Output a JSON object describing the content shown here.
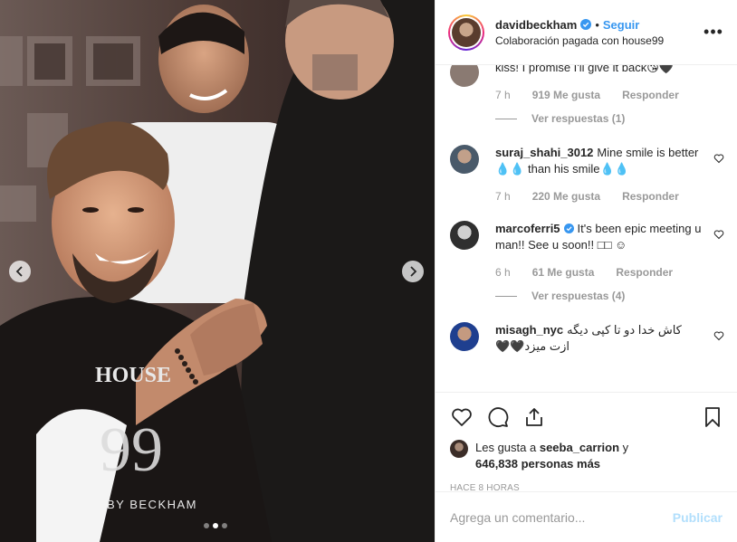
{
  "header": {
    "username": "davidbeckham",
    "separator": "•",
    "follow_label": "Seguir",
    "subtitle_prefix": "Colaboración pagada con",
    "partner": "house99",
    "more_label": "•••"
  },
  "comments": [
    {
      "user": "",
      "text": "kiss! I promise I'll give it back😘🖤",
      "time": "7 h",
      "likes": "919 Me gusta",
      "reply": "Responder",
      "view_replies": "Ver respuestas (1)"
    },
    {
      "user": "suraj_shahi_3012",
      "text": "Mine smile is better💧💧 than his smile💧💧",
      "time": "7 h",
      "likes": "220 Me gusta",
      "reply": "Responder"
    },
    {
      "user": "marcoferri5",
      "text": "It's been epic meeting u man!! See u soon!! □□ ☺",
      "time": "6 h",
      "likes": "61 Me gusta",
      "reply": "Responder",
      "view_replies": "Ver respuestas (4)"
    },
    {
      "user": "misagh_nyc",
      "text": "کاش خدا دو تا کپی دیگه ازت میزد🖤🖤"
    }
  ],
  "likes": {
    "prefix": "Les gusta a",
    "user": "seeba_carrion",
    "conj": "y",
    "count": "646,838 personas más"
  },
  "timestamp": "HACE 8 HORAS",
  "add_comment": {
    "placeholder": "Agrega un comentario...",
    "publish_label": "Publicar"
  },
  "photo": {
    "apron_text": "HOUSE",
    "apron_number": "99",
    "apron_brand": "BY BECKHAM"
  },
  "colors": {
    "link_blue": "#3897f0",
    "publish_disabled": "#b2dffc",
    "muted": "#999999"
  }
}
